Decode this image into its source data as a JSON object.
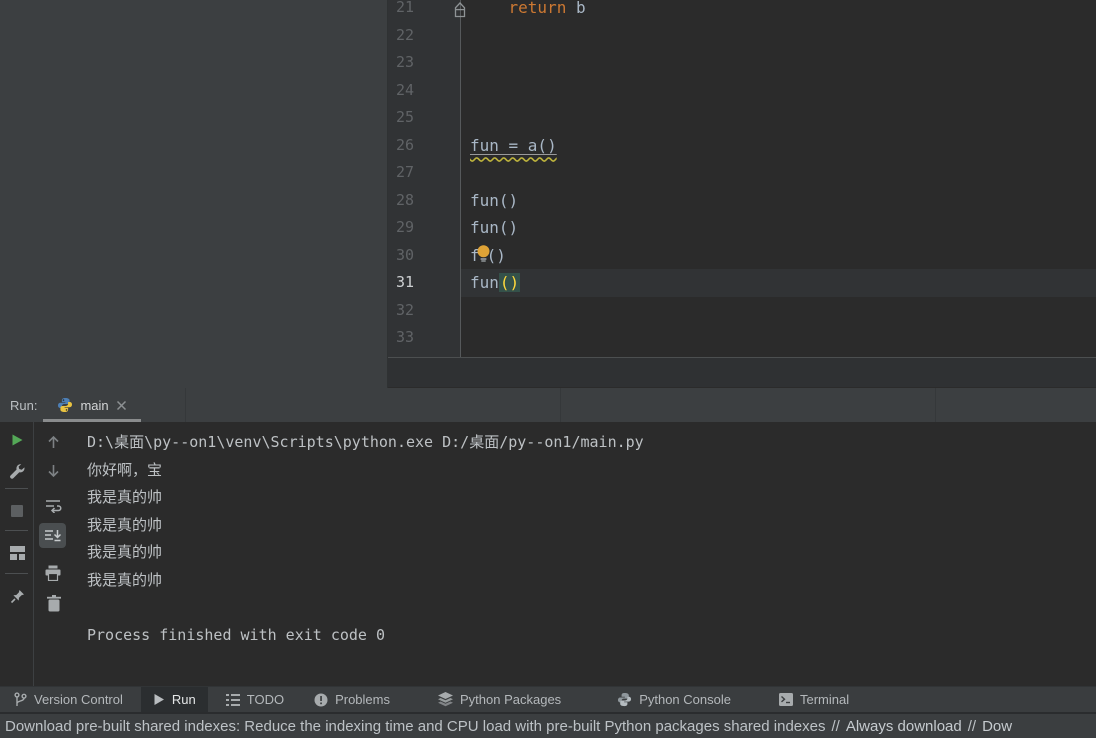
{
  "editor": {
    "lines": [
      {
        "num": "21",
        "code": {
          "indent": "    ",
          "keyword": "return",
          "after": " b"
        }
      },
      {
        "num": "22",
        "code": {}
      },
      {
        "num": "23",
        "code": {}
      },
      {
        "num": "24",
        "code": {}
      },
      {
        "num": "25",
        "code": {}
      },
      {
        "num": "26",
        "code": {
          "text": "fun = a()"
        }
      },
      {
        "num": "27",
        "code": {}
      },
      {
        "num": "28",
        "code": {
          "text": "fun()"
        }
      },
      {
        "num": "29",
        "code": {
          "text": "fun()"
        }
      },
      {
        "num": "30",
        "code": {
          "before": "f",
          "after": "()"
        }
      },
      {
        "num": "31",
        "code": {
          "name": "fun",
          "parens": "()"
        }
      },
      {
        "num": "32",
        "code": {}
      },
      {
        "num": "33",
        "code": {}
      }
    ]
  },
  "run_panel": {
    "label": "Run:",
    "tab": {
      "title": "main"
    },
    "console_lines": [
      "D:\\桌面\\py--on1\\venv\\Scripts\\python.exe D:/桌面/py--on1/main.py",
      "你好啊，宝",
      "我是真的帅",
      "我是真的帅",
      "我是真的帅",
      "我是真的帅",
      "",
      "Process finished with exit code 0"
    ]
  },
  "toolwindow_bar": {
    "items": [
      {
        "label": "Version Control"
      },
      {
        "label": "Run"
      },
      {
        "label": "TODO"
      },
      {
        "label": "Problems"
      },
      {
        "label": "Python Packages"
      },
      {
        "label": "Python Console"
      },
      {
        "label": "Terminal"
      }
    ]
  },
  "status_bar": {
    "message": "Download pre-built shared indexes: Reduce the indexing time and CPU load with pre-built Python packages shared indexes",
    "separator": "//",
    "link_always": "Always download",
    "link_truncated": "Dow"
  },
  "colors": {
    "panel_bg": "#3c3f41",
    "editor_bg": "#2b2b2b",
    "gutter_bg": "#313335",
    "keyword_orange": "#cc7832",
    "code_default": "#a9b7c6",
    "bulb_orange": "#dfa336",
    "paren_match_yellow": "#ffd93c",
    "paren_match_bg": "#34514a",
    "run_green": "#54a857",
    "current_line_bg": "#313335"
  }
}
